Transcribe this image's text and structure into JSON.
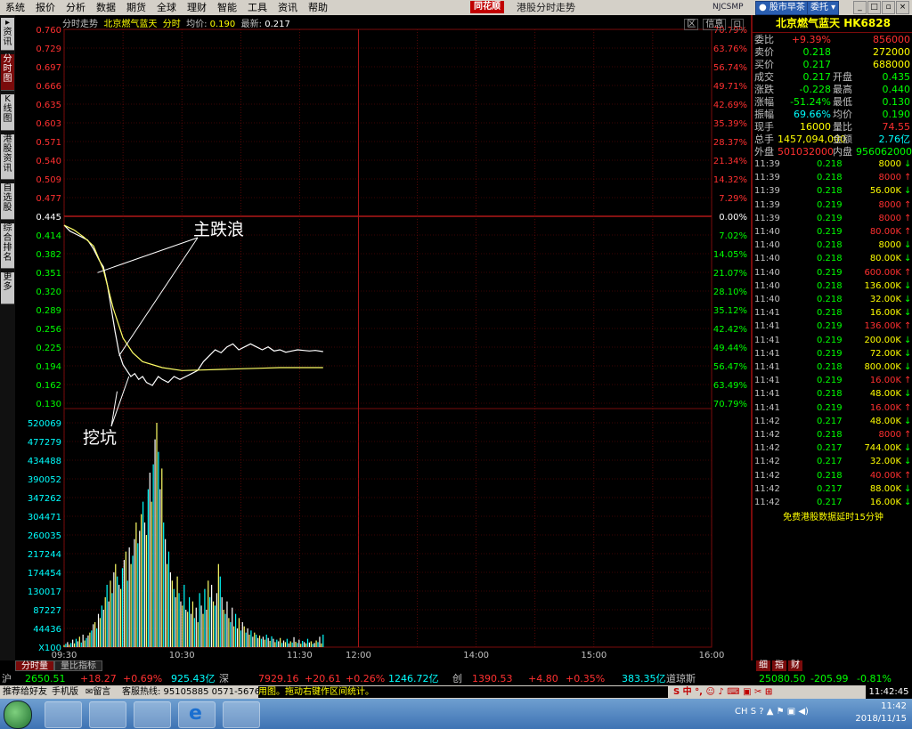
{
  "menu": {
    "items": [
      "系统",
      "报价",
      "分析",
      "数据",
      "期货",
      "全球",
      "理财",
      "智能",
      "工具",
      "资讯",
      "帮助"
    ],
    "logo": "同花顺",
    "window_title": "港股分时走势",
    "code": "NJCSMP",
    "btn_news": "股市早茶",
    "btn_entrust": "委托"
  },
  "left_tabs": [
    "资讯",
    "分时图",
    "K线图",
    "港股资讯",
    "自选股",
    "综合排名",
    "更多"
  ],
  "chart_header": {
    "type_label": "分时走势",
    "stock_name": "北京燃气蓝天",
    "mode": "分时",
    "avg_label": "均价:",
    "avg_value": "0.190",
    "last_label": "最新:",
    "last_value": "0.217",
    "btn_close": "区",
    "btn_info": "信息",
    "btn_restore": "⊡"
  },
  "bottom_tabs": [
    "分时量",
    "量比指标"
  ],
  "annotations": {
    "wave": "主跌浪",
    "pit": "挖坑"
  },
  "chart_data": {
    "type": "line",
    "x_time_labels": [
      "09:30",
      "10:30",
      "11:30",
      "12:00",
      "14:00",
      "15:00",
      "16:00"
    ],
    "price_ticks": [
      "0.760",
      "0.729",
      "0.697",
      "0.666",
      "0.635",
      "0.603",
      "0.571",
      "0.540",
      "0.509",
      "0.477",
      "0.445",
      "0.414",
      "0.382",
      "0.351",
      "0.320",
      "0.289",
      "0.256",
      "0.225",
      "0.194",
      "0.162",
      "0.130"
    ],
    "pct_ticks": [
      "70.79%",
      "63.76%",
      "56.74%",
      "49.71%",
      "42.69%",
      "35.39%",
      "28.37%",
      "21.34%",
      "14.32%",
      "7.29%",
      "0.00%",
      "7.02%",
      "14.05%",
      "21.07%",
      "28.10%",
      "35.12%",
      "42.42%",
      "49.44%",
      "56.47%",
      "63.49%",
      "70.79%"
    ],
    "prev_close": 0.445,
    "ylim": [
      0.13,
      0.76
    ],
    "volume_ticks": [
      "520069",
      "477279",
      "434488",
      "390052",
      "347262",
      "304471",
      "260035",
      "217244",
      "174454",
      "130017",
      "87227",
      "44436",
      "X100"
    ],
    "volume_max": 540000,
    "series": [
      {
        "color": "#ffffff",
        "x": [
          "09:30",
          "09:33",
          "09:36",
          "09:39",
          "09:42",
          "09:45",
          "09:48",
          "09:50",
          "09:52",
          "09:54",
          "09:56",
          "09:58",
          "10:00",
          "10:02",
          "10:04",
          "10:06",
          "10:08",
          "10:10",
          "10:12",
          "10:15",
          "10:18",
          "10:20",
          "10:23",
          "10:26",
          "10:29",
          "10:32",
          "10:35",
          "10:38",
          "10:41",
          "10:44",
          "10:47",
          "10:50",
          "10:53",
          "10:56",
          "10:59",
          "11:02",
          "11:05",
          "11:08",
          "11:11",
          "11:14",
          "11:17",
          "11:20",
          "11:23",
          "11:26",
          "11:29",
          "11:32",
          "11:35",
          "11:38",
          "11:42"
        ],
        "y": [
          0.43,
          0.42,
          0.415,
          0.41,
          0.405,
          0.39,
          0.37,
          0.36,
          0.33,
          0.29,
          0.25,
          0.215,
          0.195,
          0.185,
          0.175,
          0.18,
          0.17,
          0.175,
          0.165,
          0.16,
          0.175,
          0.17,
          0.165,
          0.175,
          0.17,
          0.175,
          0.18,
          0.185,
          0.2,
          0.21,
          0.22,
          0.215,
          0.225,
          0.23,
          0.22,
          0.225,
          0.23,
          0.225,
          0.22,
          0.225,
          0.218,
          0.22,
          0.216,
          0.218,
          0.22,
          0.219,
          0.218,
          0.219,
          0.217
        ]
      },
      {
        "color": "#ffff66",
        "x": [
          "09:30",
          "09:35",
          "09:40",
          "09:45",
          "09:50",
          "09:55",
          "10:00",
          "10:05",
          "10:10",
          "10:20",
          "10:30",
          "10:40",
          "10:50",
          "11:00",
          "11:10",
          "11:20",
          "11:30",
          "11:42"
        ],
        "y": [
          0.43,
          0.422,
          0.41,
          0.395,
          0.355,
          0.29,
          0.24,
          0.215,
          0.2,
          0.19,
          0.185,
          0.186,
          0.187,
          0.188,
          0.189,
          0.19,
          0.19,
          0.19
        ]
      }
    ],
    "volumes": [
      5000,
      8000,
      12000,
      6000,
      10000,
      18000,
      9000,
      20000,
      14000,
      25000,
      11000,
      30000,
      16000,
      22000,
      28000,
      35000,
      40000,
      55000,
      60000,
      45000,
      80000,
      70000,
      100000,
      90000,
      120000,
      150000,
      110000,
      160000,
      130000,
      180000,
      200000,
      170000,
      150000,
      140000,
      190000,
      210000,
      230000,
      160000,
      240000,
      200000,
      220000,
      260000,
      300000,
      250000,
      280000,
      320000,
      350000,
      300000,
      270000,
      380000,
      420000,
      350000,
      440000,
      500000,
      540000,
      470000,
      380000,
      430000,
      300000,
      260000,
      200000,
      230000,
      180000,
      160000,
      140000,
      120000,
      170000,
      130000,
      110000,
      100000,
      150000,
      90000,
      85000,
      120000,
      80000,
      110000,
      70000,
      95000,
      60000,
      130000,
      100000,
      80000,
      140000,
      90000,
      160000,
      120000,
      150000,
      110000,
      100000,
      130000,
      200000,
      170000,
      120000,
      90000,
      80000,
      110000,
      70000,
      60000,
      95000,
      50000,
      80000,
      45000,
      70000,
      40000,
      60000,
      50000,
      35000,
      45000,
      30000,
      40000,
      25000,
      35000,
      30000,
      22000,
      28000,
      20000,
      25000,
      18000,
      30000,
      22000,
      15000,
      26000,
      20000,
      12000,
      18000,
      14000,
      22000,
      10000,
      16000,
      12000,
      20000,
      9000,
      14000,
      11000,
      24000,
      13000,
      10000,
      18000,
      8000,
      15000,
      12000,
      9000,
      20000,
      11000,
      14000,
      8000,
      10000,
      16000,
      12000,
      25000,
      9000,
      30000
    ]
  },
  "quote": {
    "title": "北京燃气蓝天 HK6828",
    "rows": [
      {
        "l1": "委比",
        "v1": "+9.39%",
        "c1": "#ff3030",
        "l2": "",
        "v2": "856000",
        "c2": "#ff3030"
      },
      {
        "l1": "卖价",
        "v1": "0.218",
        "c1": "#00ff00",
        "l2": "",
        "v2": "272000",
        "c2": "#ffff00"
      },
      {
        "l1": "买价",
        "v1": "0.217",
        "c1": "#00ff00",
        "l2": "",
        "v2": "688000",
        "c2": "#ffff00"
      },
      {
        "l1": "成交",
        "v1": "0.217",
        "c1": "#00ff00",
        "l2": "开盘",
        "v2": "0.435",
        "c2": "#00ff00"
      },
      {
        "l1": "涨跌",
        "v1": "-0.228",
        "c1": "#00ff00",
        "l2": "最高",
        "v2": "0.440",
        "c2": "#00ff00"
      },
      {
        "l1": "涨幅",
        "v1": "-51.24%",
        "c1": "#00ff00",
        "l2": "最低",
        "v2": "0.130",
        "c2": "#00ff00"
      },
      {
        "l1": "振幅",
        "v1": "69.66%",
        "c1": "#00ffff",
        "l2": "均价",
        "v2": "0.190",
        "c2": "#00ff00"
      },
      {
        "l1": "现手",
        "v1": "16000",
        "c1": "#ffff00",
        "l2": "量比",
        "v2": "74.55",
        "c2": "#ff3030"
      },
      {
        "l1": "总手",
        "v1": "1457,094,000",
        "c1": "#ffff00",
        "l2": "金额",
        "v2": "2.76亿",
        "c2": "#00ffff"
      },
      {
        "l1": "外盘",
        "v1": "501032000",
        "c1": "#ff3030",
        "l2": "内盘",
        "v2": "956062000",
        "c2": "#00ff00"
      }
    ]
  },
  "ticks": [
    {
      "t": "11:39",
      "p": "0.218",
      "pc": "#00ff00",
      "v": "8000",
      "vc": "#ffff00",
      "d": "↓"
    },
    {
      "t": "11:39",
      "p": "0.218",
      "pc": "#00ff00",
      "v": "8000",
      "vc": "#ff3030",
      "d": "↑"
    },
    {
      "t": "11:39",
      "p": "0.218",
      "pc": "#00ff00",
      "v": "56.00K",
      "vc": "#ffff00",
      "d": "↓"
    },
    {
      "t": "11:39",
      "p": "0.219",
      "pc": "#00ff00",
      "v": "8000",
      "vc": "#ff3030",
      "d": "↑"
    },
    {
      "t": "11:39",
      "p": "0.219",
      "pc": "#00ff00",
      "v": "8000",
      "vc": "#ff3030",
      "d": "↑"
    },
    {
      "t": "11:40",
      "p": "0.219",
      "pc": "#00ff00",
      "v": "80.00K",
      "vc": "#ff3030",
      "d": "↑"
    },
    {
      "t": "11:40",
      "p": "0.218",
      "pc": "#00ff00",
      "v": "8000",
      "vc": "#ffff00",
      "d": "↓"
    },
    {
      "t": "11:40",
      "p": "0.218",
      "pc": "#00ff00",
      "v": "80.00K",
      "vc": "#ffff00",
      "d": "↓"
    },
    {
      "t": "11:40",
      "p": "0.219",
      "pc": "#00ff00",
      "v": "600.00K",
      "vc": "#ff3030",
      "d": "↑"
    },
    {
      "t": "11:40",
      "p": "0.218",
      "pc": "#00ff00",
      "v": "136.00K",
      "vc": "#ffff00",
      "d": "↓"
    },
    {
      "t": "11:40",
      "p": "0.218",
      "pc": "#00ff00",
      "v": "32.00K",
      "vc": "#ffff00",
      "d": "↓"
    },
    {
      "t": "11:41",
      "p": "0.218",
      "pc": "#00ff00",
      "v": "16.00K",
      "vc": "#ffff00",
      "d": "↓"
    },
    {
      "t": "11:41",
      "p": "0.219",
      "pc": "#00ff00",
      "v": "136.00K",
      "vc": "#ff3030",
      "d": "↑"
    },
    {
      "t": "11:41",
      "p": "0.219",
      "pc": "#00ff00",
      "v": "200.00K",
      "vc": "#ffff00",
      "d": "↓"
    },
    {
      "t": "11:41",
      "p": "0.219",
      "pc": "#00ff00",
      "v": "72.00K",
      "vc": "#ffff00",
      "d": "↓"
    },
    {
      "t": "11:41",
      "p": "0.218",
      "pc": "#00ff00",
      "v": "800.00K",
      "vc": "#ffff00",
      "d": "↓"
    },
    {
      "t": "11:41",
      "p": "0.219",
      "pc": "#00ff00",
      "v": "16.00K",
      "vc": "#ff3030",
      "d": "↑"
    },
    {
      "t": "11:41",
      "p": "0.218",
      "pc": "#00ff00",
      "v": "48.00K",
      "vc": "#ffff00",
      "d": "↓"
    },
    {
      "t": "11:41",
      "p": "0.219",
      "pc": "#00ff00",
      "v": "16.00K",
      "vc": "#ff3030",
      "d": "↑"
    },
    {
      "t": "11:42",
      "p": "0.217",
      "pc": "#00ff00",
      "v": "48.00K",
      "vc": "#ffff00",
      "d": "↓"
    },
    {
      "t": "11:42",
      "p": "0.218",
      "pc": "#00ff00",
      "v": "8000",
      "vc": "#ff3030",
      "d": "↑"
    },
    {
      "t": "11:42",
      "p": "0.217",
      "pc": "#00ff00",
      "v": "744.00K",
      "vc": "#ffff00",
      "d": "↓"
    },
    {
      "t": "11:42",
      "p": "0.217",
      "pc": "#00ff00",
      "v": "32.00K",
      "vc": "#ffff00",
      "d": "↓"
    },
    {
      "t": "11:42",
      "p": "0.218",
      "pc": "#00ff00",
      "v": "40.00K",
      "vc": "#ff3030",
      "d": "↑"
    },
    {
      "t": "11:42",
      "p": "0.217",
      "pc": "#00ff00",
      "v": "88.00K",
      "vc": "#ffff00",
      "d": "↓"
    },
    {
      "t": "11:42",
      "p": "0.217",
      "pc": "#00ff00",
      "v": "16.00K",
      "vc": "#ffff00",
      "d": "↓"
    }
  ],
  "delay_note": "免费港股数据延时15分钟",
  "right_tabs": [
    "细",
    "指",
    "财"
  ],
  "ticker": {
    "sh_label": "沪",
    "sh_val": "2650.51",
    "sh_chg": "+18.27",
    "sh_pct": "+0.69%",
    "sh_amt": "925.43亿",
    "sz_label": "深",
    "sz_val": "7929.16",
    "sz_chg": "+20.61",
    "sz_pct": "+0.26%",
    "sz_amt": "1246.72亿",
    "cy_label": "创",
    "cy_val": "1390.53",
    "cy_chg": "+4.80",
    "cy_pct": "+0.35%",
    "cy_amt": "383.35亿",
    "dj_label": "道琼斯",
    "dj_val": "25080.50",
    "dj_chg": "-205.99",
    "dj_pct": "-0.81%"
  },
  "status": {
    "recommend": "推荐给好友",
    "mobile": "手机版",
    "message": "留言",
    "hotline": "客服热线: 95105885 0571-56768888",
    "scroll": "用图。拖动右键作区间统计。",
    "clock": "11:42:45"
  },
  "tray": {
    "time": "11:42",
    "date": "2018/11/15",
    "lang": "CH"
  }
}
